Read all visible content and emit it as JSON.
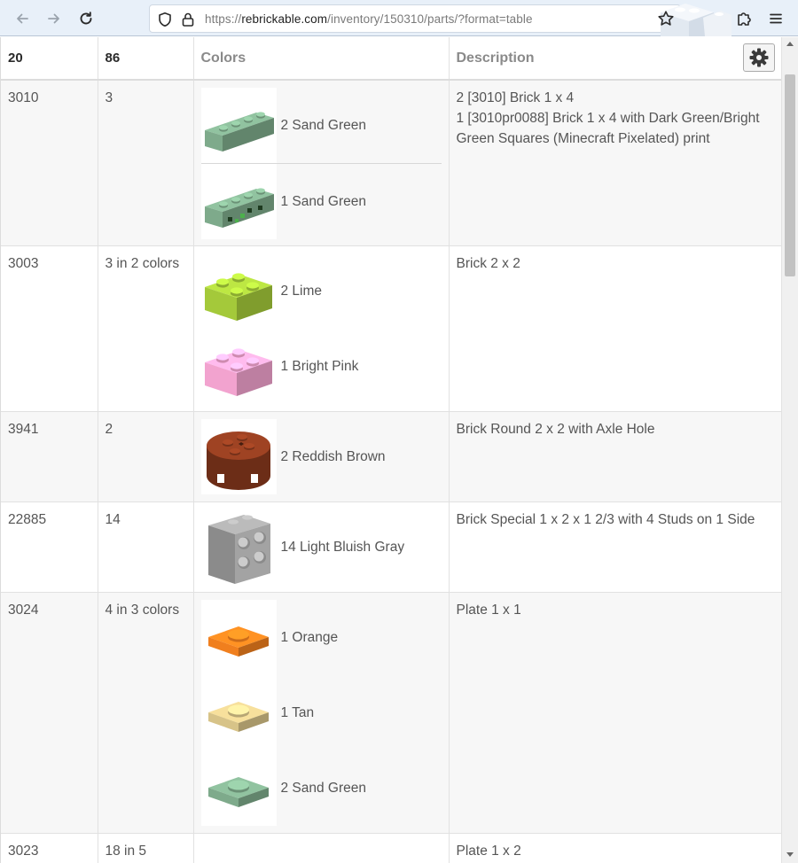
{
  "browser": {
    "url_prefix": "https://",
    "url_host": "rebrickable.com",
    "url_path": "/inventory/150310/parts/?format=table"
  },
  "table": {
    "headers": {
      "part_count": "20",
      "qty_total": "86",
      "colors": "Colors",
      "description": "Description"
    },
    "rows": [
      {
        "part": "3010",
        "qty": "3",
        "colors": [
          {
            "label": "2 Sand Green",
            "color": "#7eaa8b",
            "icon": "brick-1x4-icon"
          },
          {
            "label": "1 Sand Green",
            "color": "#7eaa8b",
            "icon": "brick-1x4-minecraft-icon"
          }
        ],
        "description": [
          "2 [3010] Brick 1 x 4",
          "1 [3010pr0088] Brick 1 x 4 with Dark Green/Bright Green Squares (Minecraft Pixelated) print"
        ]
      },
      {
        "part": "3003",
        "qty": "3 in 2 colors",
        "colors": [
          {
            "label": "2 Lime",
            "color": "#a4c93a",
            "icon": "brick-2x2-icon"
          },
          {
            "label": "1 Bright Pink",
            "color": "#f2a3cf",
            "icon": "brick-2x2-icon"
          }
        ],
        "description": [
          "Brick 2 x 2"
        ]
      },
      {
        "part": "3941",
        "qty": "2",
        "colors": [
          {
            "label": "2 Reddish Brown",
            "color": "#8a3a1e",
            "icon": "brick-round-2x2-icon"
          }
        ],
        "description": [
          "Brick Round 2 x 2 with Axle Hole"
        ]
      },
      {
        "part": "22885",
        "qty": "14",
        "colors": [
          {
            "label": "14 Light Bluish Gray",
            "color": "#a3a3a3",
            "icon": "brick-side-studs-icon"
          }
        ],
        "description": [
          "Brick Special 1 x 2 x 1 2/3 with 4 Studs on 1 Side"
        ]
      },
      {
        "part": "3024",
        "qty": "4 in 3 colors",
        "colors": [
          {
            "label": "1 Orange",
            "color": "#f07f1e",
            "icon": "plate-1x1-icon"
          },
          {
            "label": "1 Tan",
            "color": "#d7c388",
            "icon": "plate-1x1-icon"
          },
          {
            "label": "2 Sand Green",
            "color": "#7eaa8b",
            "icon": "plate-1x1-icon"
          }
        ],
        "description": [
          "Plate 1 x 1"
        ]
      },
      {
        "part": "3023",
        "qty": "18 in 5",
        "colors": [],
        "description": [
          "Plate 1 x 2"
        ]
      }
    ]
  },
  "icons": {
    "back": "arrow-left-icon",
    "forward": "arrow-right-icon",
    "reload": "reload-icon",
    "shield": "shield-icon",
    "lock": "lock-icon",
    "bookmark": "star-icon",
    "extensions": "puzzle-icon",
    "menu": "hamburger-icon",
    "settings": "gear-icon"
  }
}
